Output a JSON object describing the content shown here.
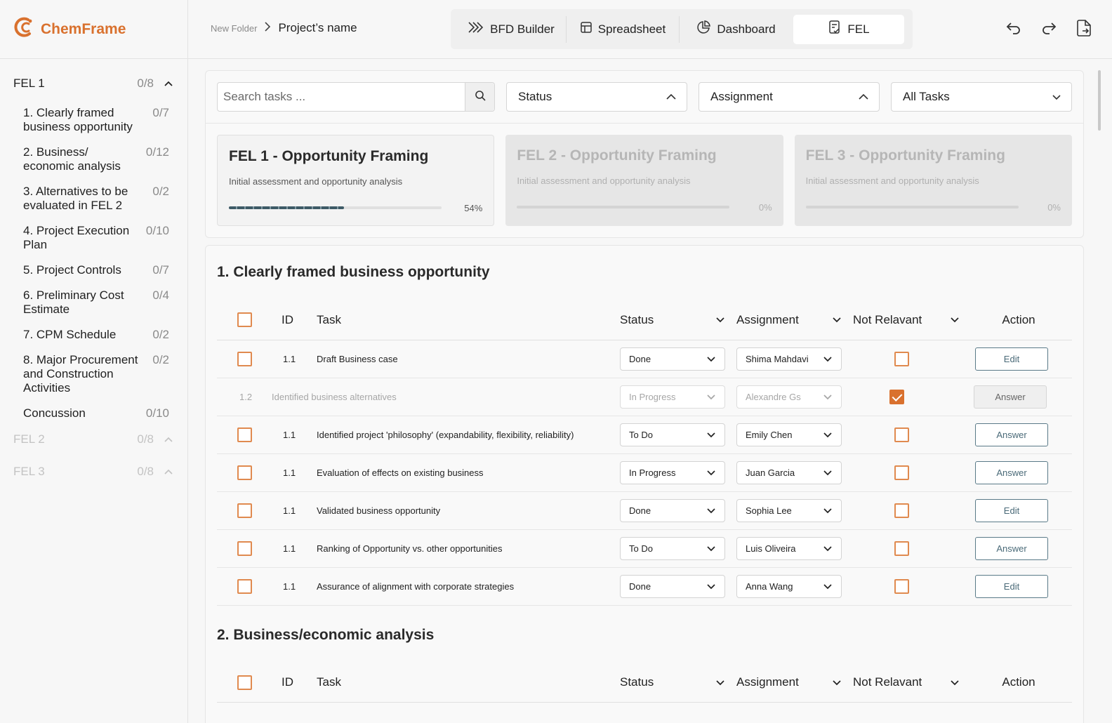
{
  "app": {
    "name": "ChemFrame",
    "accent": "#d9712e"
  },
  "breadcrumb": {
    "folder": "New Folder",
    "project": "Project’s name"
  },
  "tabs": [
    {
      "label": "BFD Builder",
      "icon": "bfd-icon"
    },
    {
      "label": "Spreadsheet",
      "icon": "table-icon"
    },
    {
      "label": "Dashboard",
      "icon": "pie-chart-icon"
    },
    {
      "label": "FEL",
      "icon": "checklist-icon",
      "active": true
    }
  ],
  "sidebar": {
    "groups": [
      {
        "name": "FEL 1",
        "count": "0/8",
        "expanded": true
      },
      {
        "name": "FEL 2",
        "count": "0/8"
      },
      {
        "name": "FEL 3",
        "count": "0/8"
      }
    ],
    "items": [
      {
        "label": "1. Clearly framed business opportunity",
        "count": "0/7"
      },
      {
        "label": "2. Business/ economic analysis",
        "count": "0/12"
      },
      {
        "label": "3. Alternatives to be evaluated in FEL 2",
        "count": "0/2"
      },
      {
        "label": "4. Project Execution Plan",
        "count": "0/10"
      },
      {
        "label": "5. Project Controls",
        "count": "0/7"
      },
      {
        "label": "6. Preliminary Cost Estimate",
        "count": "0/4"
      },
      {
        "label": "7. CPM Schedule",
        "count": "0/2"
      },
      {
        "label": "8. Major Procurement and Construction Activities",
        "count": "0/2"
      },
      {
        "label": "Concussion",
        "count": "0/10"
      }
    ]
  },
  "filters": {
    "search_placeholder": "Search tasks ...",
    "status": "Status",
    "assignment": "Assignment",
    "all_tasks": "All Tasks"
  },
  "cards": [
    {
      "title": "FEL 1 - Opportunity Framing",
      "subtitle": "Initial assessment and opportunity analysis",
      "progress_label": "54%",
      "progress": 0.54
    },
    {
      "title": "FEL 2 - Opportunity Framing",
      "subtitle": "Initial assessment and opportunity analysis",
      "progress_label": "0%",
      "progress": 0
    },
    {
      "title": "FEL 3 - Opportunity Framing",
      "subtitle": "Initial assessment and opportunity analysis",
      "progress_label": "0%",
      "progress": 0
    }
  ],
  "table_headers": {
    "id": "ID",
    "task": "Task",
    "status": "Status",
    "assignment": "Assignment",
    "not_relevant": "Not Relavant",
    "action": "Action"
  },
  "sections": [
    {
      "title": "1. Clearly framed business opportunity",
      "rows": [
        {
          "id": "1.1",
          "task": "Draft Business case",
          "status": "Done",
          "assignee": "Shima Mahdavi",
          "not_relevant": false,
          "action": "Edit"
        },
        {
          "id": "1.2",
          "task": "Identified business alternatives",
          "status": "In Progress",
          "assignee": "Alexandre Gs",
          "not_relevant": true,
          "action": "Answer",
          "disabled": true
        },
        {
          "id": "1.1",
          "task": "Identified project 'philosophy' (expandability, flexibility, reliability)",
          "status": "To Do",
          "assignee": "Emily Chen",
          "not_relevant": false,
          "action": "Answer"
        },
        {
          "id": "1.1",
          "task": "Evaluation of effects on existing business",
          "status": "In Progress",
          "assignee": "Juan Garcia",
          "not_relevant": false,
          "action": "Answer"
        },
        {
          "id": "1.1",
          "task": "Validated business opportunity",
          "status": "Done",
          "assignee": "Sophia Lee",
          "not_relevant": false,
          "action": "Edit"
        },
        {
          "id": "1.1",
          "task": "Ranking of Opportunity vs. other opportunities",
          "status": "To Do",
          "assignee": "Luis Oliveira",
          "not_relevant": false,
          "action": "Answer"
        },
        {
          "id": "1.1",
          "task": "Assurance of alignment with corporate strategies",
          "status": "Done",
          "assignee": "Anna Wang",
          "not_relevant": false,
          "action": "Edit"
        }
      ]
    },
    {
      "title": "2. Business/economic analysis",
      "rows": []
    }
  ]
}
